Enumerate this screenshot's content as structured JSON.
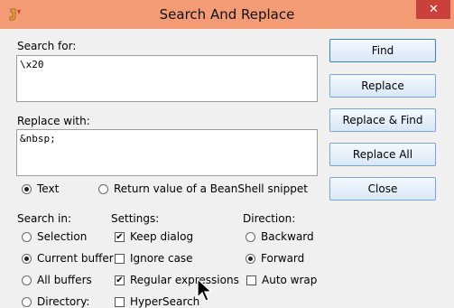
{
  "window": {
    "title": "Search And Replace",
    "close_symbol": "✕"
  },
  "search": {
    "label": "Search for:",
    "value": "\\x20"
  },
  "replace": {
    "label": "Replace with:",
    "value": "&nbsp;"
  },
  "mode": {
    "text_label": "Text",
    "beanshell_label": "Return value of a BeanShell snippet",
    "selected": "text"
  },
  "search_in": {
    "heading": "Search in:",
    "options": [
      "Selection",
      "Current buffer",
      "All buffers",
      "Directory:"
    ],
    "selected": "Current buffer"
  },
  "settings": {
    "heading": "Settings:",
    "options": [
      {
        "label": "Keep dialog",
        "checked": true
      },
      {
        "label": "Ignore case",
        "checked": false
      },
      {
        "label": "Regular expressions",
        "checked": true
      },
      {
        "label": "HyperSearch",
        "checked": false
      }
    ]
  },
  "direction": {
    "heading": "Direction:",
    "options": [
      "Backward",
      "Forward"
    ],
    "selected": "Forward",
    "auto_wrap_label": "Auto wrap",
    "auto_wrap_checked": false
  },
  "buttons": {
    "find": "Find",
    "replace": "Replace",
    "replace_find": "Replace & Find",
    "replace_all": "Replace All",
    "close": "Close"
  },
  "colors": {
    "titlebar": "#f29b75",
    "close": "#c9413a",
    "button_border": "#7aa6d6"
  }
}
